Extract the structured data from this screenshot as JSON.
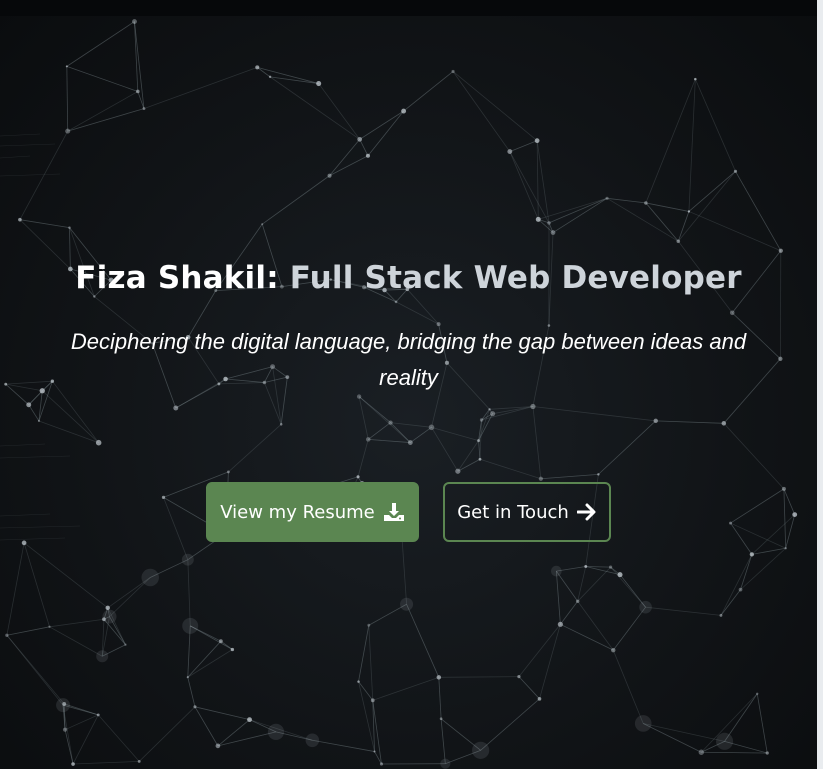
{
  "hero": {
    "name": "Fiza Shakil:",
    "role": " Full Stack Web Developer",
    "tagline": "Deciphering the digital language, bridging the gap between ideas and reality"
  },
  "actions": {
    "resume_label": "View my Resume",
    "resume_icon": "download-icon",
    "contact_label": "Get in Touch",
    "contact_icon": "arrow-right-icon"
  },
  "colors": {
    "accent": "#5b8651",
    "background": "#0c0e10",
    "title_primary": "#ffffff",
    "title_secondary": "#ced4da"
  }
}
